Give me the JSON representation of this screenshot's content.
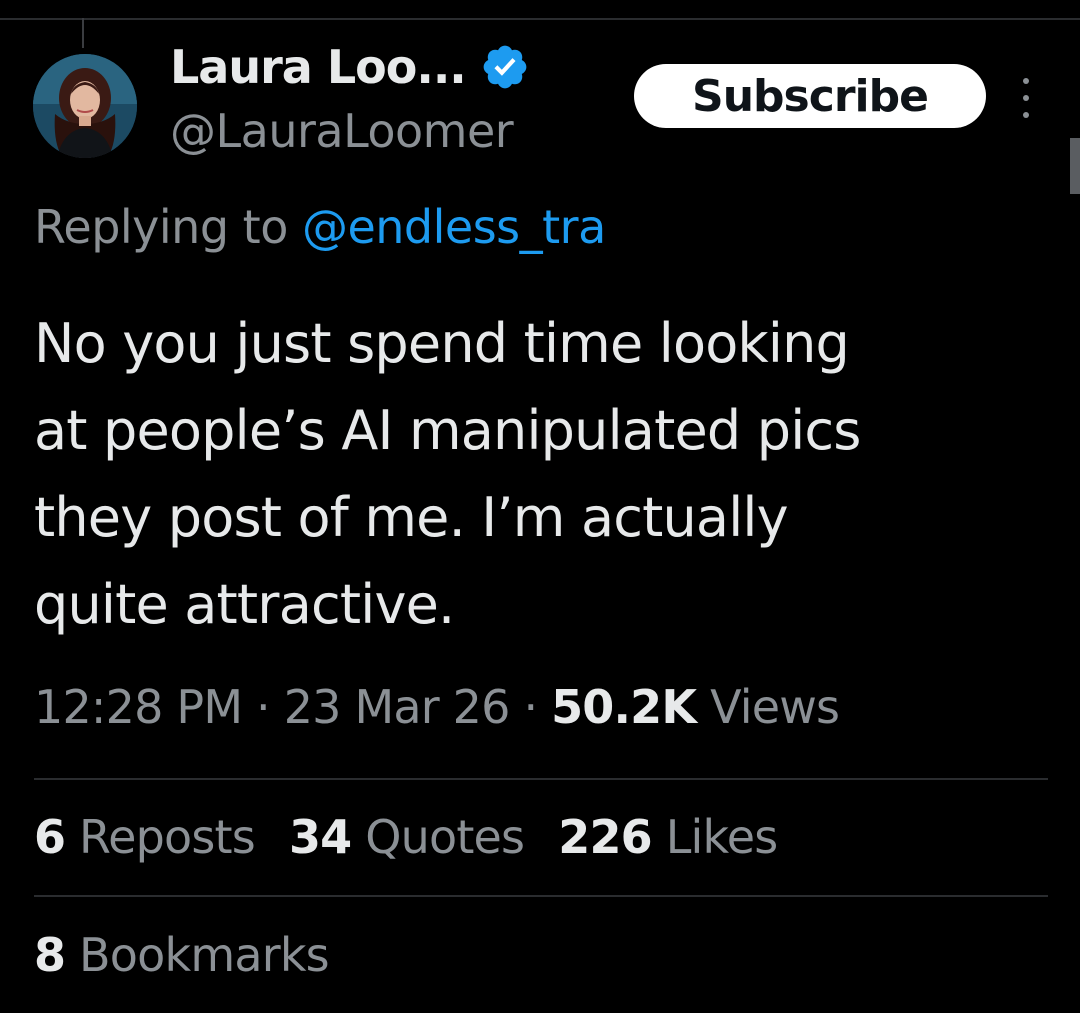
{
  "colors": {
    "background": "#000000",
    "text_primary": "#e7e9ea",
    "text_secondary": "#8b9095",
    "link": "#1d9bf0",
    "verified_badge": "#1d9bf0",
    "subscribe_bg": "#ffffff",
    "divider": "#2a2c2f"
  },
  "author": {
    "display_name": "Laura Loo...",
    "handle": "@LauraLoomer",
    "verified_icon": "verified-badge-icon",
    "avatar_icon": "user-avatar"
  },
  "header": {
    "subscribe_label": "Subscribe",
    "more_icon": "more-vertical-icon"
  },
  "reply": {
    "prefix": "Replying to",
    "handle": "@endless_tra"
  },
  "tweet": {
    "lines": [
      "No you just spend time looking",
      "at people’s AI manipulated pics",
      "they post of me. I’m actually",
      "quite attractive."
    ]
  },
  "meta": {
    "time": "12:28 PM",
    "separator": "·",
    "date": "23 Mar 26",
    "views_count": "50.2K",
    "views_label": "Views"
  },
  "stats": {
    "reposts": {
      "count": "6",
      "label": "Reposts"
    },
    "quotes": {
      "count": "34",
      "label": "Quotes"
    },
    "likes": {
      "count": "226",
      "label": "Likes"
    },
    "bookmarks": {
      "count": "8",
      "label": "Bookmarks"
    }
  }
}
